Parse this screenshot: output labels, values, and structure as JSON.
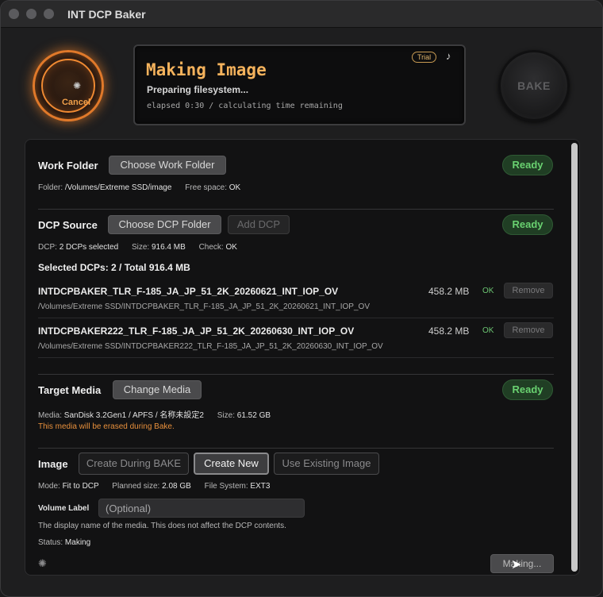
{
  "window": {
    "title": "INT DCP Baker"
  },
  "header": {
    "cancel_label": "Cancel",
    "cancel_spinner": "✺",
    "status_title": "Making Image",
    "status_sub": "Preparing filesystem...",
    "status_elapsed": "elapsed 0:30 / calculating time remaining",
    "trial_badge": "Trial",
    "music_icon": "♪",
    "bake_label": "BAKE"
  },
  "work_folder": {
    "label": "Work Folder",
    "button": "Choose Work Folder",
    "status": "Ready",
    "folder_label": "Folder:",
    "folder_value": "/Volumes/Extreme SSD/image",
    "free_label": "Free space:",
    "free_value": "OK"
  },
  "dcp_source": {
    "label": "DCP Source",
    "choose_button": "Choose DCP Folder",
    "add_button": "Add DCP",
    "status": "Ready",
    "dcp_label": "DCP:",
    "dcp_value": "2 DCPs selected",
    "size_label": "Size:",
    "size_value": "916.4 MB",
    "check_label": "Check:",
    "check_value": "OK",
    "selected_summary": "Selected DCPs: 2 / Total 916.4 MB",
    "items": [
      {
        "name": "INTDCPBAKER_TLR_F-185_JA_JP_51_2K_20260621_INT_IOP_OV",
        "path": "/Volumes/Extreme SSD/INTDCPBAKER_TLR_F-185_JA_JP_51_2K_20260621_INT_IOP_OV",
        "size": "458.2 MB",
        "check": "OK",
        "remove": "Remove"
      },
      {
        "name": "INTDCPBAKER222_TLR_F-185_JA_JP_51_2K_20260630_INT_IOP_OV",
        "path": "/Volumes/Extreme SSD/INTDCPBAKER222_TLR_F-185_JA_JP_51_2K_20260630_INT_IOP_OV",
        "size": "458.2 MB",
        "check": "OK",
        "remove": "Remove"
      }
    ]
  },
  "target_media": {
    "label": "Target Media",
    "button": "Change Media",
    "status": "Ready",
    "media_label": "Media:",
    "media_value": "SanDisk 3.2Gen1 / APFS / 名称未設定2",
    "size_label": "Size:",
    "size_value": "61.52 GB",
    "warning": "This media will be erased during Bake."
  },
  "image": {
    "label": "Image",
    "create_during_bake": "Create During BAKE",
    "create_new": "Create New",
    "use_existing": "Use Existing Image",
    "mode_label": "Mode:",
    "mode_value": "Fit to DCP",
    "planned_label": "Planned size:",
    "planned_value": "2.08 GB",
    "fs_label": "File System:",
    "fs_value": "EXT3",
    "volume_label": "Volume Label",
    "volume_placeholder": "(Optional)",
    "volume_help": "The display name of the media. This does not affect the DCP contents.",
    "status_label": "Status:",
    "status_value": "Making",
    "spinner": "✺",
    "making_button": "Making..."
  },
  "cursor_icon": "➤",
  "colors": {
    "accent_orange": "#f08a32",
    "ready_green": "#69d170",
    "warning_orange": "#e8903c",
    "status_title": "#f4b25c"
  }
}
